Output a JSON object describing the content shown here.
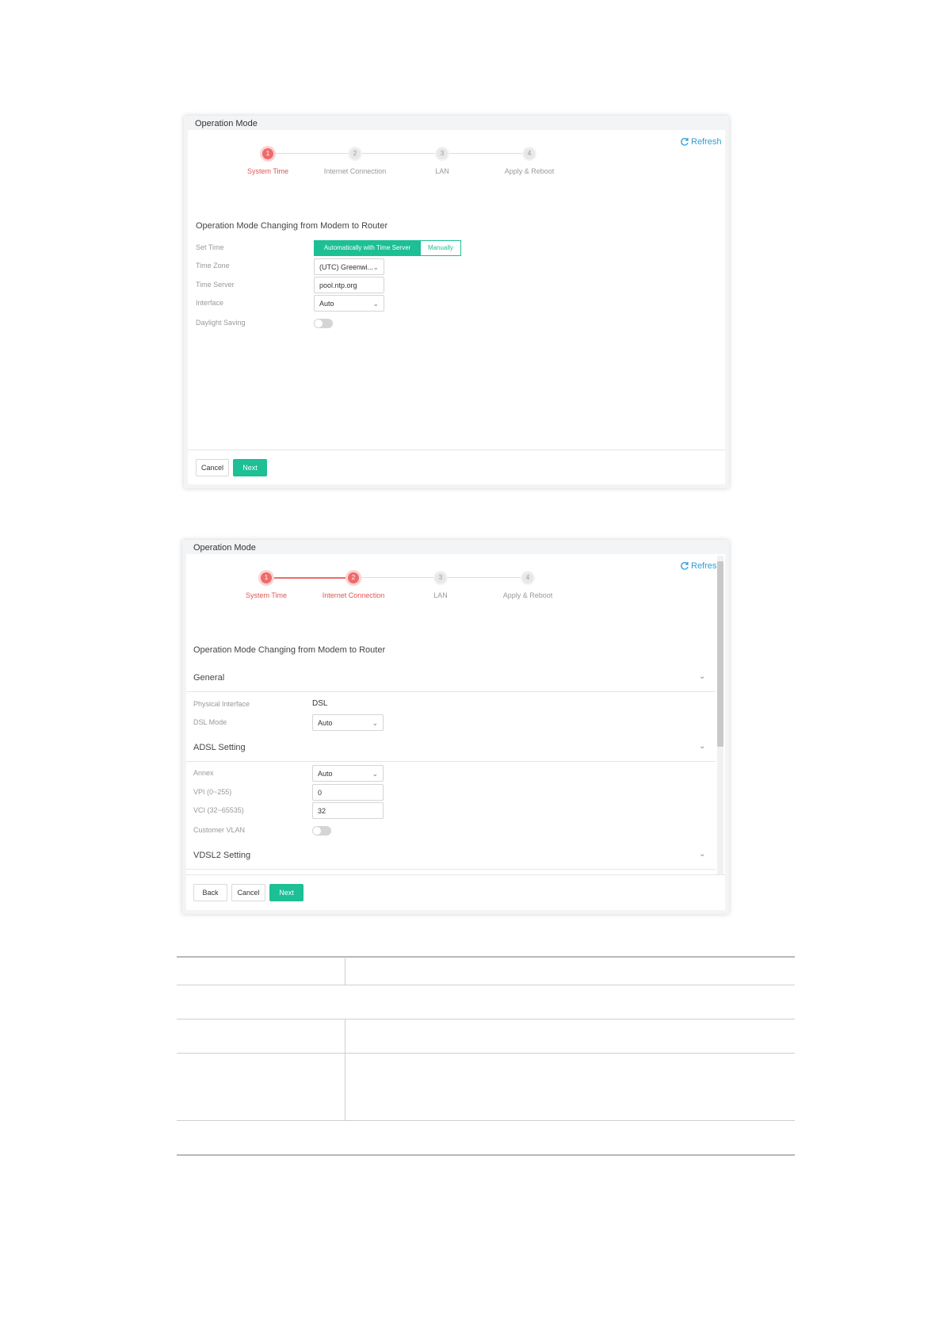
{
  "panel1": {
    "title": "Operation Mode",
    "refresh": "Refresh",
    "steps": [
      {
        "num": "1",
        "label": "System Time"
      },
      {
        "num": "2",
        "label": "Internet Connection"
      },
      {
        "num": "3",
        "label": "LAN"
      },
      {
        "num": "4",
        "label": "Apply & Reboot"
      }
    ],
    "heading": "Operation Mode Changing from Modem to Router",
    "set_time_label": "Set Time",
    "set_time_options": [
      "Automatically with Time Server",
      "Manually"
    ],
    "time_zone_label": "Time Zone",
    "time_zone_value": "(UTC) Greenwi...",
    "time_server_label": "Time Server",
    "time_server_value": "pool.ntp.org",
    "interface_label": "Interface",
    "interface_value": "Auto",
    "daylight_label": "Daylight Saving",
    "cancel": "Cancel",
    "next": "Next"
  },
  "panel2": {
    "title": "Operation Mode",
    "refresh": "Refresh",
    "steps": [
      {
        "num": "1",
        "label": "System Time"
      },
      {
        "num": "2",
        "label": "Internet Connection"
      },
      {
        "num": "3",
        "label": "LAN"
      },
      {
        "num": "4",
        "label": "Apply & Reboot"
      }
    ],
    "heading": "Operation Mode Changing from Modem to Router",
    "general": "General",
    "physical_interface_label": "Physical Interface",
    "physical_interface_value": "DSL",
    "dsl_mode_label": "DSL Mode",
    "dsl_mode_value": "Auto",
    "adsl": "ADSL Setting",
    "annex_label": "Annex",
    "annex_value": "Auto",
    "vpi_label": "VPI (0~255)",
    "vpi_value": "0",
    "vci_label": "VCI (32~65535)",
    "vci_value": "32",
    "customer_vlan_label": "Customer VLAN",
    "vdsl2": "VDSL2 Setting",
    "back": "Back",
    "cancel": "Cancel",
    "next": "Next"
  }
}
